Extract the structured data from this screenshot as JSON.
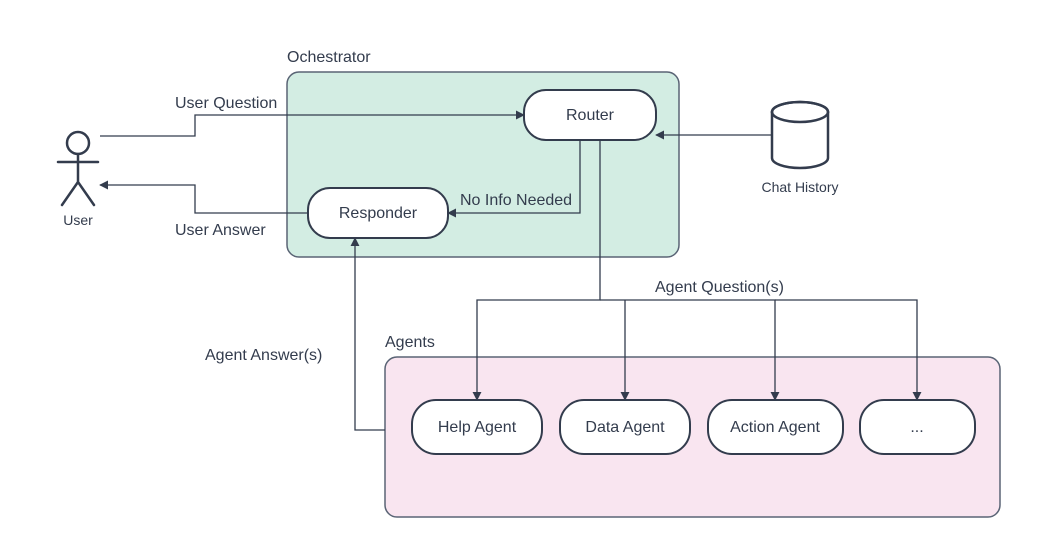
{
  "user_label": "User",
  "orchestrator": {
    "title": "Ochestrator",
    "router": "Router",
    "responder": "Responder"
  },
  "chat_history": "Chat History",
  "agents": {
    "title": "Agents",
    "help": "Help Agent",
    "data": "Data Agent",
    "action": "Action Agent",
    "more": "..."
  },
  "edges": {
    "user_question": "User Question",
    "user_answer": "User Answer",
    "no_info": "No Info Needed",
    "agent_questions": "Agent Question(s)",
    "agent_answers": "Agent Answer(s)"
  }
}
